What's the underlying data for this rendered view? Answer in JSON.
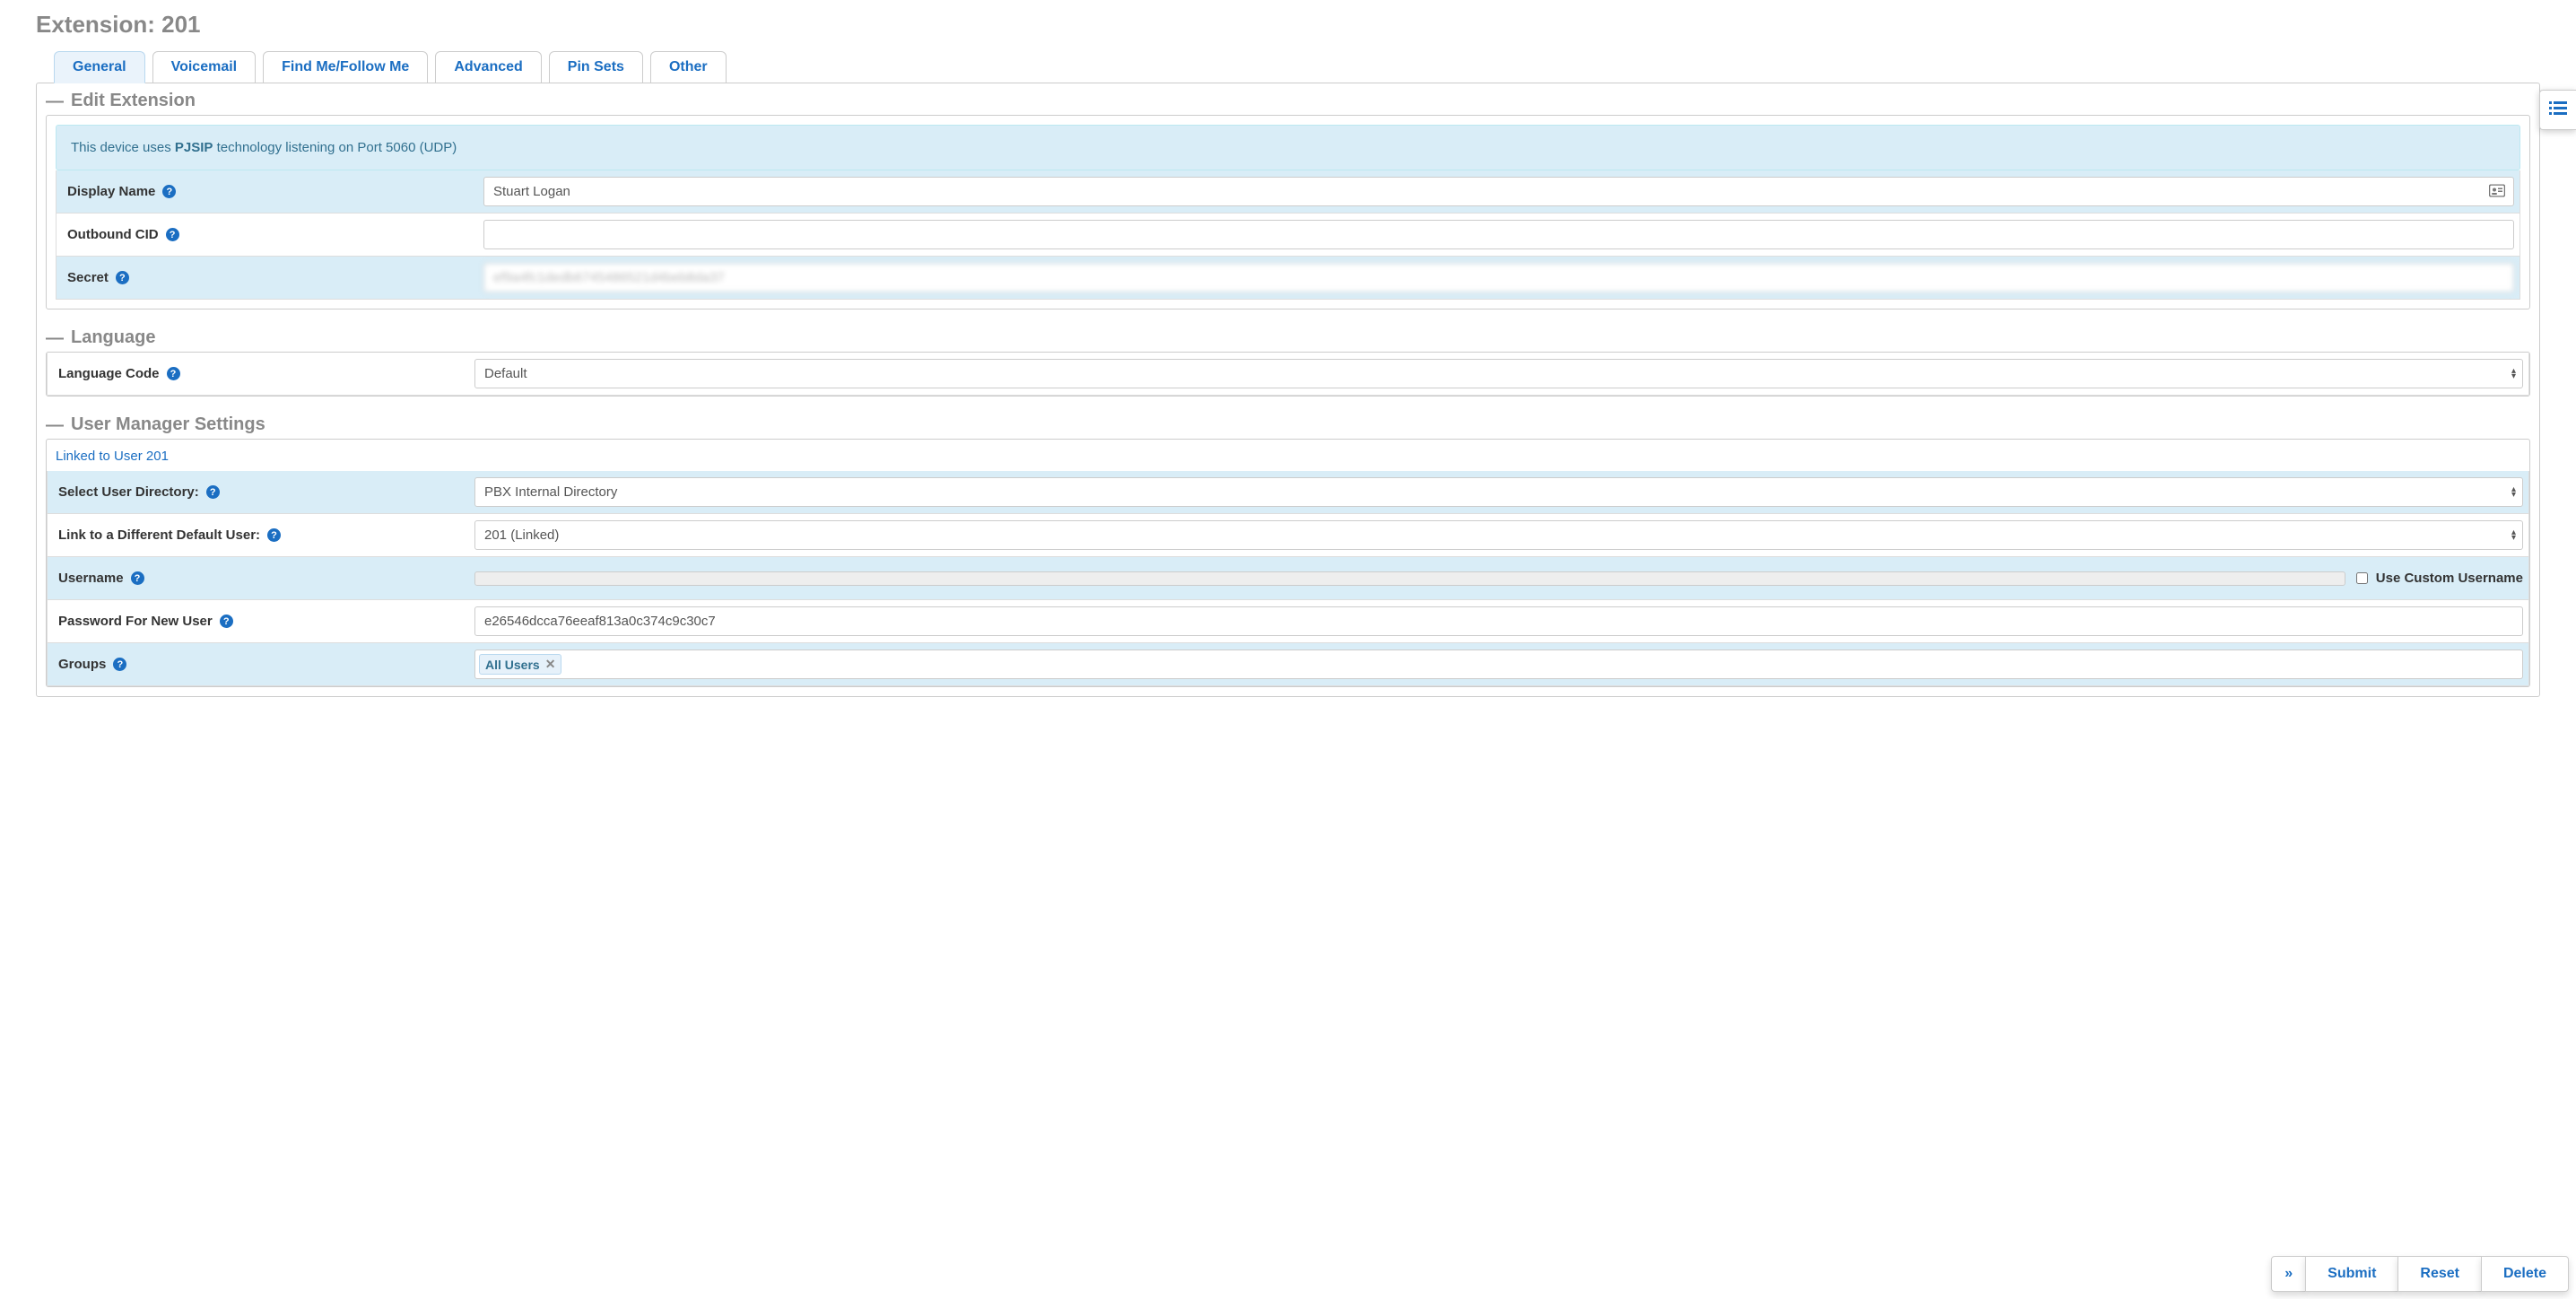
{
  "page_title": "Extension: 201",
  "tabs": [
    "General",
    "Voicemail",
    "Find Me/Follow Me",
    "Advanced",
    "Pin Sets",
    "Other"
  ],
  "active_tab": "General",
  "sections": {
    "edit_extension": "Edit Extension",
    "language": "Language",
    "user_manager": "User Manager Settings"
  },
  "info_prefix": "This device uses ",
  "info_tech": "PJSIP",
  "info_suffix": " technology listening on Port 5060 (UDP)",
  "fields": {
    "display_name": "Display Name",
    "outbound_cid": "Outbound CID",
    "secret": "Secret",
    "language_code": "Language Code",
    "select_user_directory": "Select User Directory:",
    "link_default_user": "Link to a Different Default User:",
    "username": "Username",
    "use_custom_username": "Use Custom Username",
    "password_new_user": "Password For New User",
    "groups": "Groups"
  },
  "values": {
    "display_name": "Stuart Logan",
    "outbound_cid": "",
    "secret": "ef9a4fc1dedb6745486521d4beb8da37",
    "language_code": "Default",
    "user_directory": "PBX Internal Directory",
    "link_user": "201 (Linked)",
    "username": "",
    "password": "e26546dcca76eeaf813a0c374c9c30c7"
  },
  "linked_title": "Linked to User 201",
  "groups": [
    "All Users"
  ],
  "buttons": {
    "expand": "»",
    "submit": "Submit",
    "reset": "Reset",
    "delete": "Delete"
  }
}
